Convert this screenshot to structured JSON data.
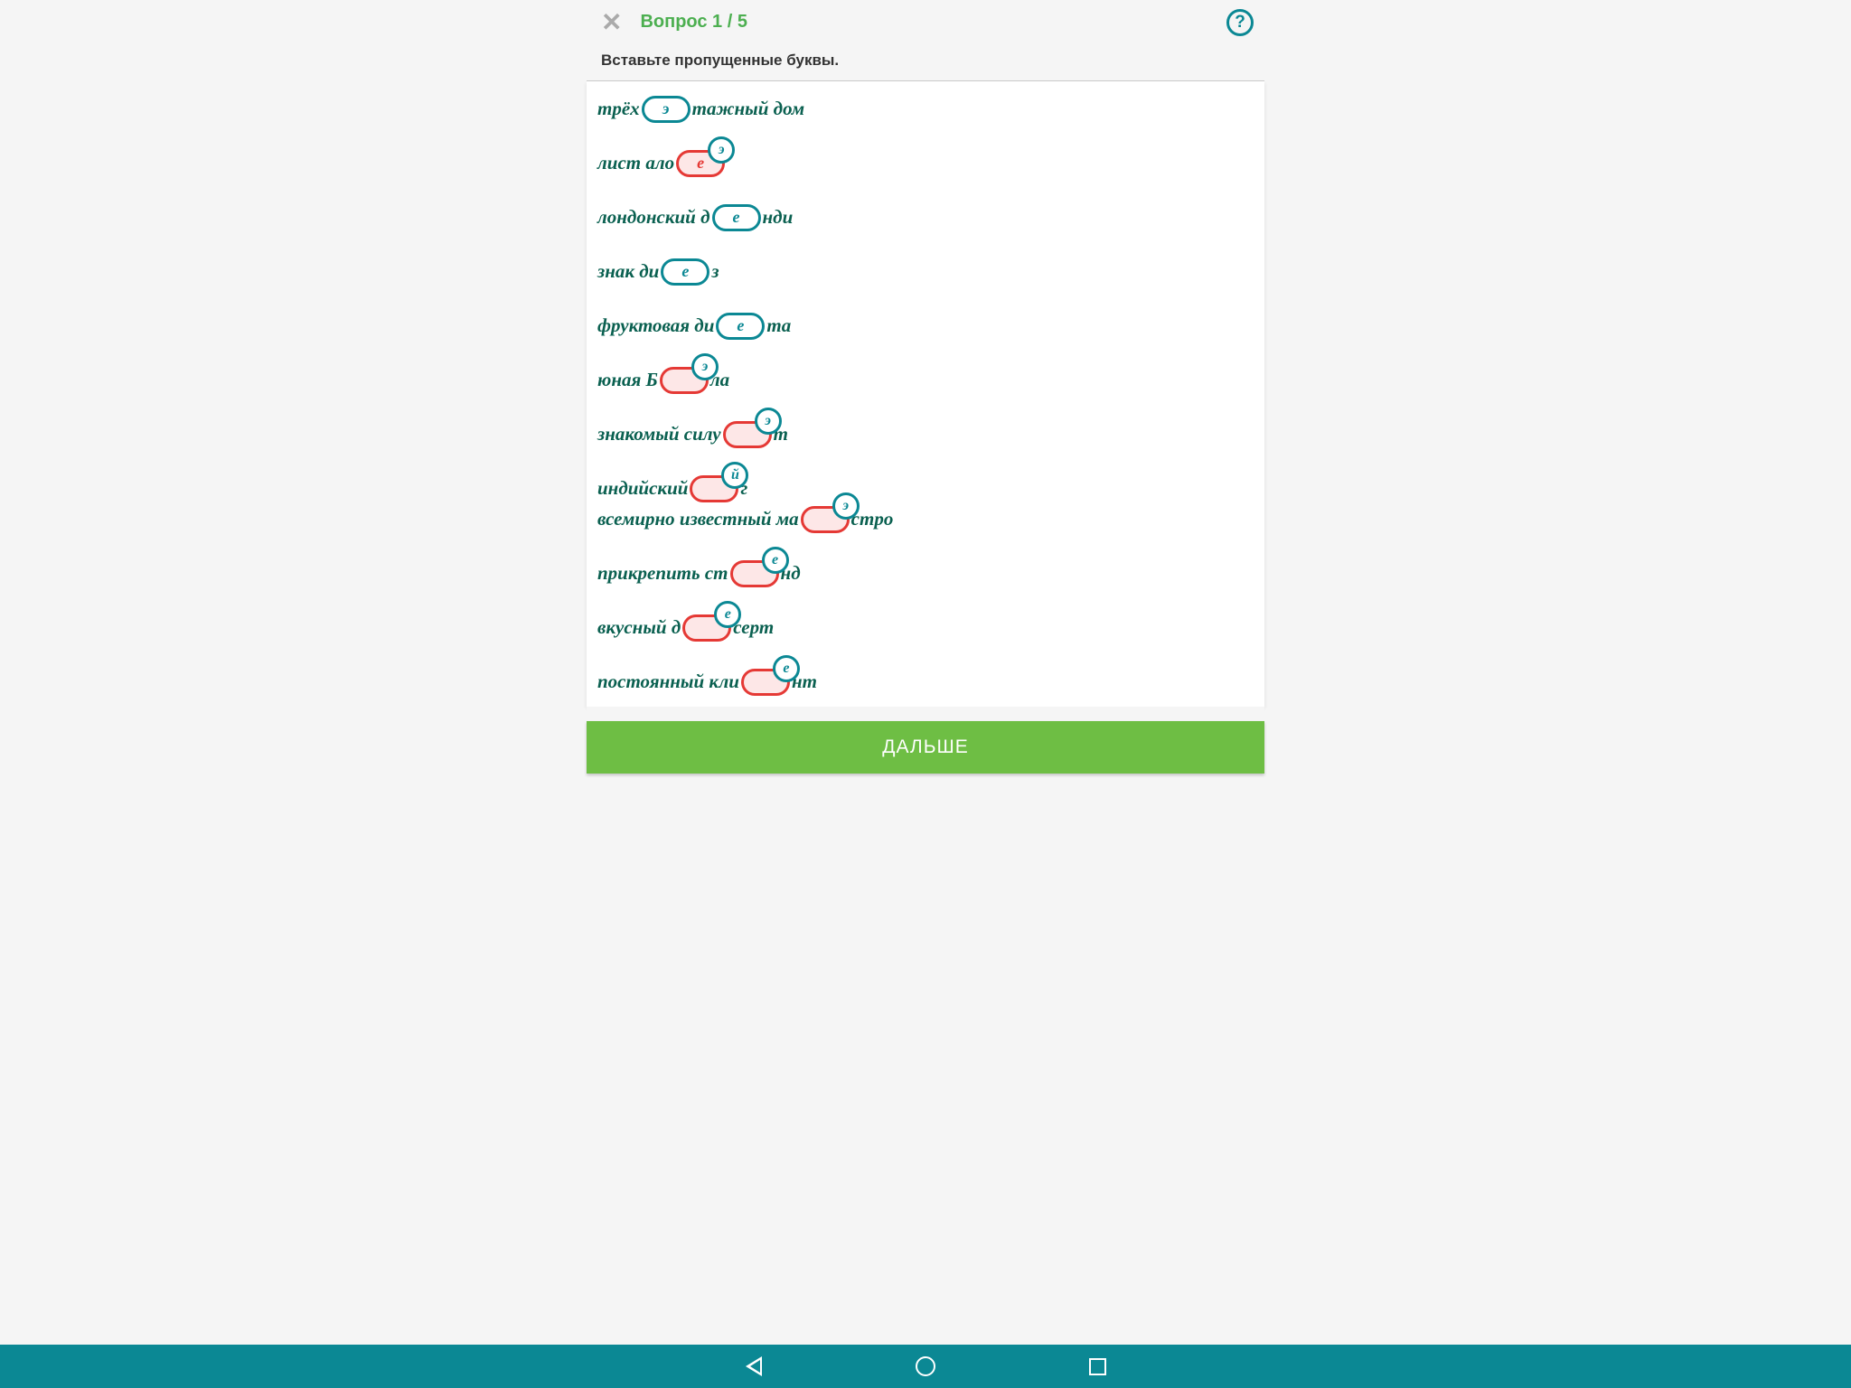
{
  "header": {
    "question_label": "Вопрос 1 / 5",
    "help_symbol": "?"
  },
  "instruction": "Вставьте пропущенные буквы.",
  "lines": [
    {
      "pre": "трёх",
      "pill": {
        "text": "э",
        "state": "correct"
      },
      "post": "тажный дом"
    },
    {
      "pre": "лист ало",
      "pill": {
        "text": "е",
        "state": "wrong",
        "badge": "э"
      },
      "post": ""
    },
    {
      "pre": "лондонский д",
      "pill": {
        "text": "е",
        "state": "correct"
      },
      "post": "нди"
    },
    {
      "pre": "знак ди",
      "pill": {
        "text": "е",
        "state": "correct"
      },
      "post": "з"
    },
    {
      "pre": "фруктовая ди",
      "pill": {
        "text": "е",
        "state": "correct"
      },
      "post": "та"
    },
    {
      "pre": "юная Б",
      "pill": {
        "text": "",
        "state": "wrong",
        "badge": "э"
      },
      "post": "ла"
    },
    {
      "pre": "знакомый силу",
      "pill": {
        "text": "",
        "state": "wrong",
        "badge": "э"
      },
      "post": "т"
    },
    {
      "pre": "индийский ",
      "pill": {
        "text": "",
        "state": "wrong",
        "badge": "й"
      },
      "post": "г",
      "tight": true
    },
    {
      "pre": "всемирно известный ма",
      "pill": {
        "text": "",
        "state": "wrong",
        "badge": "э"
      },
      "post": "стро"
    },
    {
      "pre": "прикрепить ст",
      "pill": {
        "text": "",
        "state": "wrong",
        "badge": "е"
      },
      "post": "нд"
    },
    {
      "pre": "вкусный д",
      "pill": {
        "text": "",
        "state": "wrong",
        "badge": "е"
      },
      "post": "серт"
    },
    {
      "pre": "постоянный кли",
      "pill": {
        "text": "",
        "state": "wrong",
        "badge": "е"
      },
      "post": "нт"
    }
  ],
  "next_button": "ДАЛЬШЕ"
}
